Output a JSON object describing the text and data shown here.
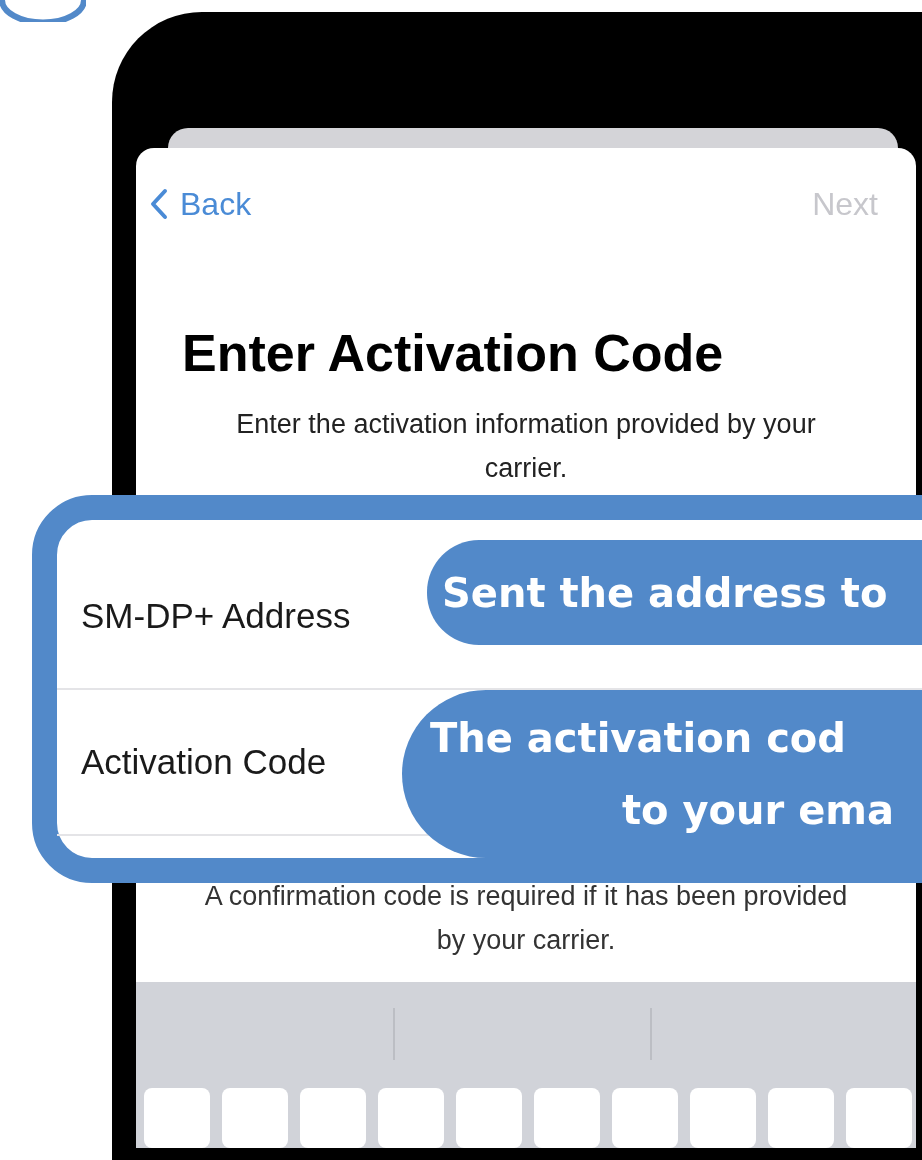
{
  "nav": {
    "back": "Back",
    "next": "Next",
    "next_disabled": true
  },
  "title": "Enter Activation Code",
  "subtitle": "Enter the activation information provided by your carrier.",
  "fields": [
    {
      "label": "SM-DP+ Address",
      "callout": [
        "Sent the address to"
      ]
    },
    {
      "label": "Activation Code",
      "callout": [
        "The activation cod",
        "to your ema"
      ]
    }
  ],
  "footnote": "A confirmation code is required if it has been provided by your carrier."
}
